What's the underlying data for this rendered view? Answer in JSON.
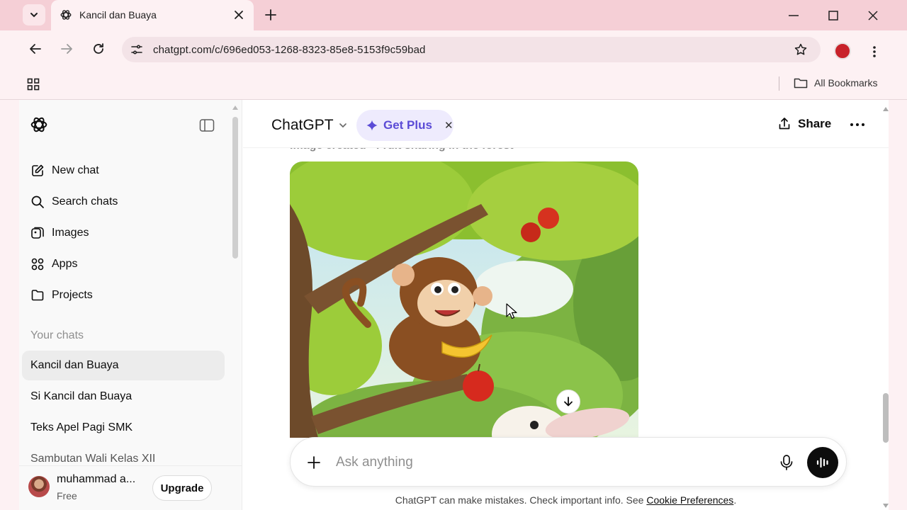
{
  "browser": {
    "tab_title": "Kancil dan Buaya",
    "url": "chatgpt.com/c/696ed053-1268-8323-85e8-5153f9c59bad",
    "all_bookmarks_label": "All Bookmarks",
    "tab_bg": "#fdf1f3",
    "tabbar_bg": "#f5cfd6"
  },
  "sidebar": {
    "nav": [
      {
        "label": "New chat",
        "icon": "edit-icon"
      },
      {
        "label": "Search chats",
        "icon": "search-icon"
      },
      {
        "label": "Images",
        "icon": "images-icon"
      },
      {
        "label": "Apps",
        "icon": "apps-icon"
      },
      {
        "label": "Projects",
        "icon": "folder-icon"
      }
    ],
    "section_label": "Your chats",
    "chats": [
      {
        "title": "Kancil dan Buaya",
        "active": true
      },
      {
        "title": "Si Kancil dan Buaya"
      },
      {
        "title": "Teks Apel Pagi SMK"
      },
      {
        "title": "Sambutan Wali Kelas XII"
      }
    ],
    "user": {
      "name": "muhammad a...",
      "plan": "Free",
      "upgrade_label": "Upgrade"
    }
  },
  "header": {
    "model": "ChatGPT",
    "get_plus_label": "Get Plus",
    "share_label": "Share",
    "accent": "#5b4bd6"
  },
  "conversation": {
    "image_caption": "Image created  ·  Fruit sharing in the forest"
  },
  "composer": {
    "placeholder": "Ask anything",
    "disclaimer_prefix": "ChatGPT can make mistakes. Check important info. See ",
    "disclaimer_link": "Cookie Preferences",
    "disclaimer_suffix": "."
  }
}
